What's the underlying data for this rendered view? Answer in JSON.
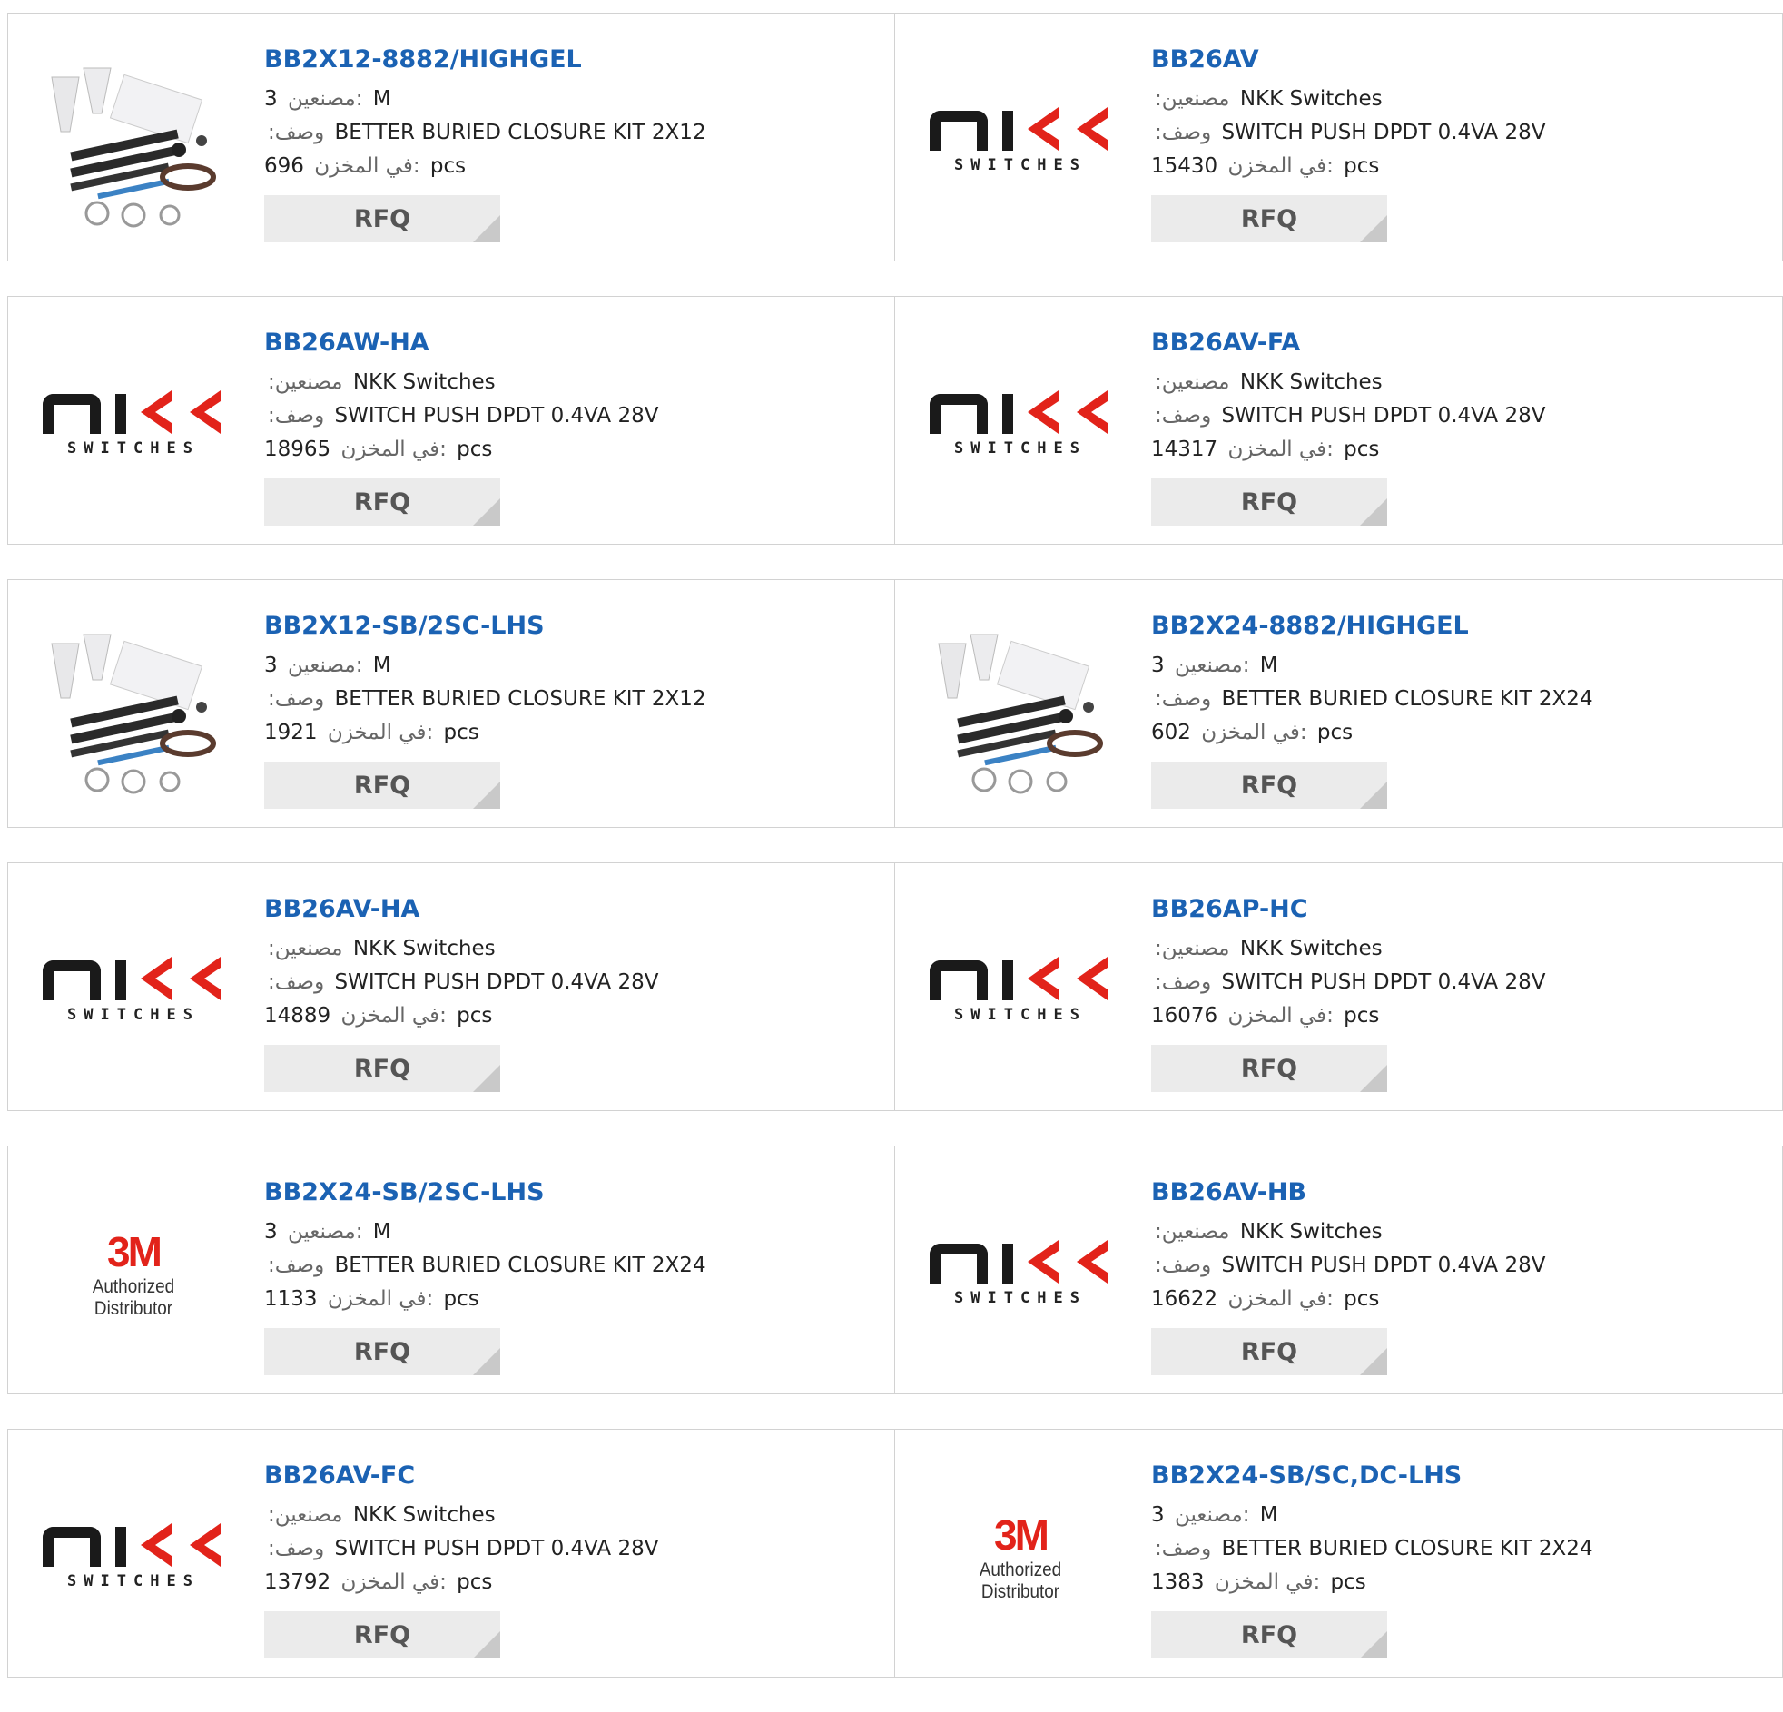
{
  "labels": {
    "manufacturer": ":مصنعين",
    "description": ":وصف",
    "in_stock": "في المخزن:",
    "unit": "pcs",
    "rfq": "RFQ"
  },
  "products": [
    {
      "part": "BB2X12-8882/HIGHGEL",
      "mfr_value": "3",
      "mfr_text": "M",
      "mfr_label": "مصنعين:",
      "desc": "BETTER BURIED CLOSURE KIT 2X12",
      "stock": "696",
      "image": "kit-photo"
    },
    {
      "part": "BB26AV",
      "mfr_value": "",
      "mfr_text": "NKK Switches",
      "mfr_label": ":مصنعين",
      "desc": "SWITCH PUSH DPDT 0.4VA 28V",
      "stock": "15430",
      "image": "nkk-logo"
    },
    {
      "part": "BB26AW-HA",
      "mfr_value": "",
      "mfr_text": "NKK Switches",
      "mfr_label": ":مصنعين",
      "desc": "SWITCH PUSH DPDT 0.4VA 28V",
      "stock": "18965",
      "image": "nkk-logo"
    },
    {
      "part": "BB26AV-FA",
      "mfr_value": "",
      "mfr_text": "NKK Switches",
      "mfr_label": ":مصنعين",
      "desc": "SWITCH PUSH DPDT 0.4VA 28V",
      "stock": "14317",
      "image": "nkk-logo"
    },
    {
      "part": "BB2X12-SB/2SC-LHS",
      "mfr_value": "3",
      "mfr_text": "M",
      "mfr_label": "مصنعين:",
      "desc": "BETTER BURIED CLOSURE KIT 2X12",
      "stock": "1921",
      "image": "kit-photo"
    },
    {
      "part": "BB2X24-8882/HIGHGEL",
      "mfr_value": "3",
      "mfr_text": "M",
      "mfr_label": "مصنعين:",
      "desc": "BETTER BURIED CLOSURE KIT 2X24",
      "stock": "602",
      "image": "kit-photo"
    },
    {
      "part": "BB26AV-HA",
      "mfr_value": "",
      "mfr_text": "NKK Switches",
      "mfr_label": ":مصنعين",
      "desc": "SWITCH PUSH DPDT 0.4VA 28V",
      "stock": "14889",
      "image": "nkk-logo"
    },
    {
      "part": "BB26AP-HC",
      "mfr_value": "",
      "mfr_text": "NKK Switches",
      "mfr_label": ":مصنعين",
      "desc": "SWITCH PUSH DPDT 0.4VA 28V",
      "stock": "16076",
      "image": "nkk-logo"
    },
    {
      "part": "BB2X24-SB/2SC-LHS",
      "mfr_value": "3",
      "mfr_text": "M",
      "mfr_label": "مصنعين:",
      "desc": "BETTER BURIED CLOSURE KIT 2X24",
      "stock": "1133",
      "image": "3m-logo"
    },
    {
      "part": "BB26AV-HB",
      "mfr_value": "",
      "mfr_text": "NKK Switches",
      "mfr_label": ":مصنعين",
      "desc": "SWITCH PUSH DPDT 0.4VA 28V",
      "stock": "16622",
      "image": "nkk-logo"
    },
    {
      "part": "BB26AV-FC",
      "mfr_value": "",
      "mfr_text": "NKK Switches",
      "mfr_label": ":مصنعين",
      "desc": "SWITCH PUSH DPDT 0.4VA 28V",
      "stock": "13792",
      "image": "nkk-logo"
    },
    {
      "part": "BB2X24-SB/SC,DC-LHS",
      "mfr_value": "3",
      "mfr_text": "M",
      "mfr_label": "مصنعين:",
      "desc": "BETTER BURIED CLOSURE KIT 2X24",
      "stock": "1383",
      "image": "3m-logo"
    }
  ],
  "logos": {
    "nkk_sub": "SWITCHES",
    "m3_mark": "3M",
    "m3_sub": "Authorized Distributor"
  },
  "colors": {
    "link": "#1b62b3",
    "rfq_bg": "#ebebeb",
    "border": "#d2d2d2",
    "m3_red": "#e2231a"
  }
}
